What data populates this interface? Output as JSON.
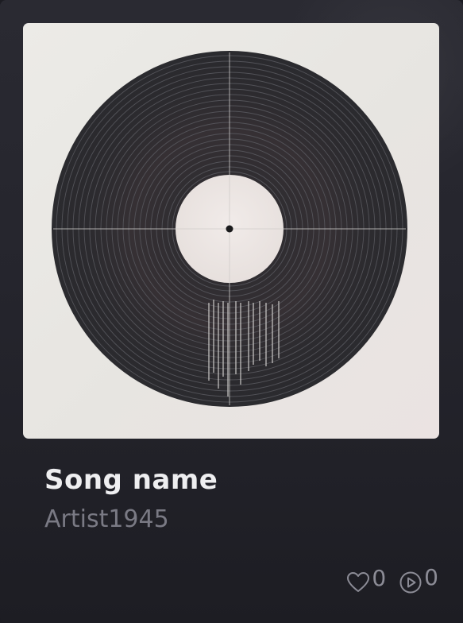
{
  "song": {
    "title": "Song name",
    "artist": "Artist1945"
  },
  "stats": {
    "likes": "0",
    "plays": "0"
  },
  "icons": {
    "like": "heart-outline-icon",
    "plays": "play-circle-icon"
  },
  "colors": {
    "card_bg": "#26262e",
    "title": "#eeeef0",
    "artist": "#7a7a84",
    "stats": "#8c8c96",
    "vinyl": "#2b2b2f",
    "label": "#ebe4e1"
  }
}
